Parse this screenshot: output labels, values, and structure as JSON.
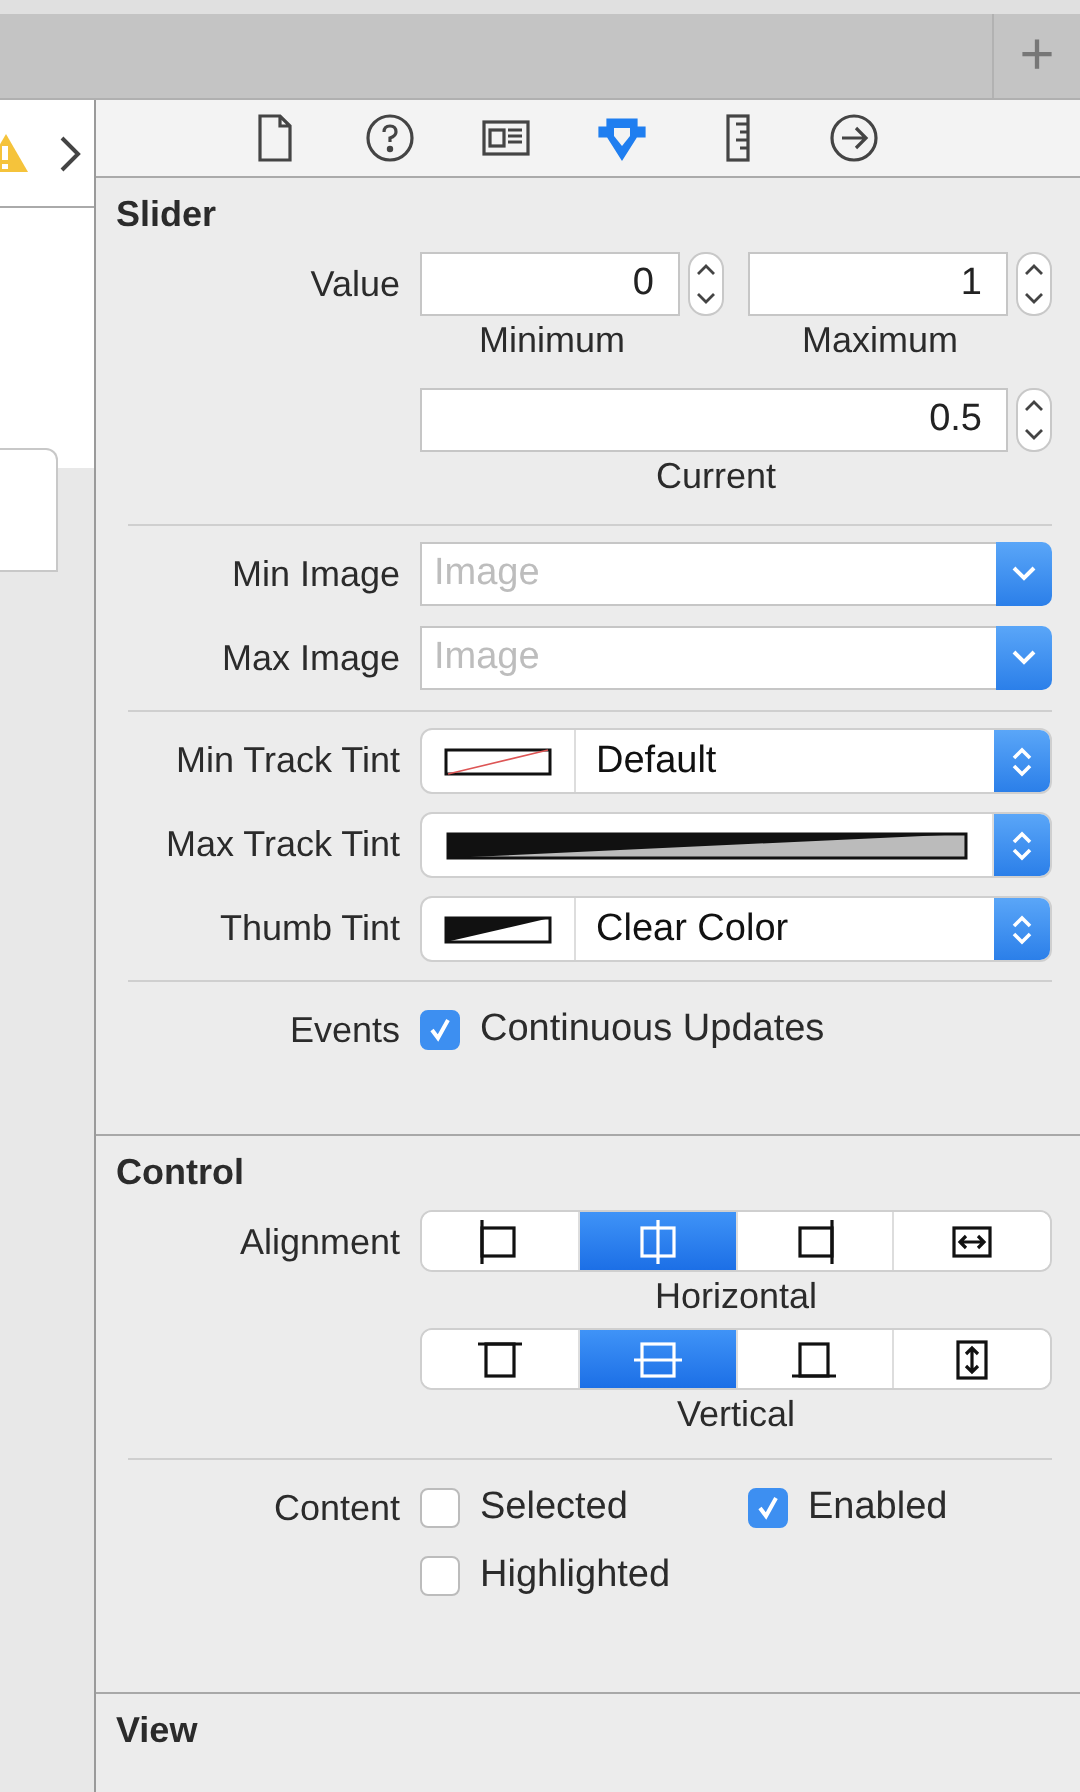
{
  "tab_bar": {
    "add_button": "+"
  },
  "inspector_tabs": [
    {
      "kind": "file",
      "selected": false
    },
    {
      "kind": "help",
      "selected": false
    },
    {
      "kind": "identity",
      "selected": false
    },
    {
      "kind": "attributes",
      "selected": true
    },
    {
      "kind": "size",
      "selected": false
    },
    {
      "kind": "connections",
      "selected": false
    }
  ],
  "slider": {
    "title": "Slider",
    "value_label": "Value",
    "range_fields": [
      {
        "value": "0",
        "caption": "Minimum"
      },
      {
        "value": "1",
        "caption": "Maximum"
      }
    ],
    "current_field": {
      "value": "0.5",
      "caption": "Current"
    },
    "image_rows": [
      {
        "label": "Min Image",
        "placeholder": "Image"
      },
      {
        "label": "Max Image",
        "placeholder": "Image"
      }
    ],
    "tint_rows": [
      {
        "label": "Min Track Tint",
        "kind": "default",
        "value": "Default"
      },
      {
        "label": "Max Track Tint",
        "kind": "wide"
      },
      {
        "label": "Thumb Tint",
        "kind": "clear",
        "value": "Clear Color"
      }
    ],
    "events": {
      "label": "Events",
      "checkbox": {
        "label": "Continuous Updates",
        "checked": true
      }
    }
  },
  "control": {
    "title": "Control",
    "alignment_label": "Alignment",
    "horizontal": {
      "caption": "Horizontal",
      "segments": [
        {
          "kind": "left",
          "selected": false
        },
        {
          "kind": "center",
          "selected": true
        },
        {
          "kind": "right",
          "selected": false
        },
        {
          "kind": "fill",
          "selected": false
        }
      ]
    },
    "vertical": {
      "caption": "Vertical",
      "segments": [
        {
          "kind": "top",
          "selected": false
        },
        {
          "kind": "middle",
          "selected": true
        },
        {
          "kind": "bottom",
          "selected": false
        },
        {
          "kind": "fill",
          "selected": false
        }
      ]
    },
    "content_label": "Content",
    "content_checkboxes": [
      {
        "label": "Selected",
        "checked": false
      },
      {
        "label": "Enabled",
        "checked": true
      },
      {
        "label": "Highlighted",
        "checked": false
      }
    ]
  },
  "view": {
    "title": "View"
  }
}
